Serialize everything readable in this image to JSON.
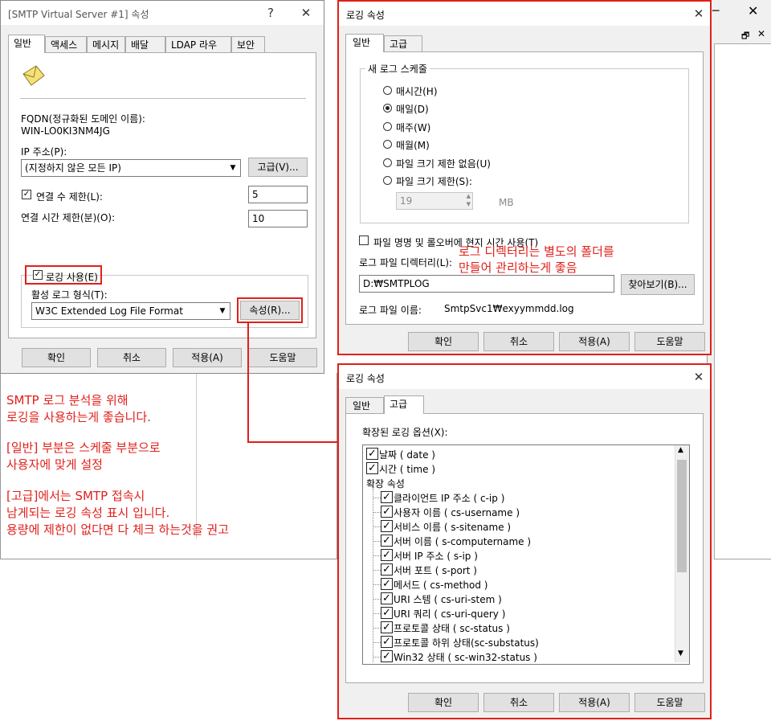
{
  "smtp_dialog": {
    "title": "[SMTP Virtual Server #1] 속성",
    "tabs": [
      "일반",
      "액세스",
      "메시지",
      "배달",
      "LDAP 라우팅",
      "보안"
    ],
    "fqdn_label": "FQDN(정규화된 도메인 이름):",
    "fqdn_value": "WIN-LO0KI3NM4JG",
    "ip_label": "IP 주소(P):",
    "ip_value": "(지정하지 않은 모든 IP)",
    "advanced_button": "고급(V)...",
    "limit_connections_label": "연결 수 제한(L):",
    "limit_connections_value": "5",
    "timeout_label": "연결 시간 제한(분)(O):",
    "timeout_value": "10",
    "enable_logging_label": "로깅 사용(E)",
    "log_format_label": "활성 로그 형식(T):",
    "log_format_value": "W3C Extended Log File Format",
    "properties_button": "속성(R)...",
    "buttons": {
      "ok": "확인",
      "cancel": "취소",
      "apply": "적용(A)",
      "help": "도움말"
    }
  },
  "logging_general": {
    "title": "로깅 속성",
    "tabs": [
      "일반",
      "고급"
    ],
    "schedule_group": "새 로그 스케줄",
    "schedule_options": [
      "매시간(H)",
      "매일(D)",
      "매주(W)",
      "매월(M)",
      "파일 크기 제한 없음(U)",
      "파일 크기 제한(S):"
    ],
    "selected_schedule": "매일(D)",
    "file_size_value": "19",
    "file_size_unit": "MB",
    "local_time_label": "파일 명명 및 롤오버에 현지 시간 사용(T)",
    "log_dir_label": "로그 파일 디렉터리(L):",
    "log_dir_value": "D:₩SMTPLOG",
    "browse_button": "찾아보기(B)...",
    "log_file_name_label": "로그 파일 이름:",
    "log_file_name_value": "SmtpSvc1₩exyymmdd.log",
    "annotation": [
      "로그 디렉터리는 별도의 폴더를",
      "만들어 관리하는게 좋음"
    ],
    "buttons": {
      "ok": "확인",
      "cancel": "취소",
      "apply": "적용(A)",
      "help": "도움말"
    }
  },
  "logging_advanced": {
    "title": "로깅 속성",
    "tabs": [
      "일반",
      "고급"
    ],
    "extended_options_label": "확장된 로깅 옵션(X):",
    "top_items": [
      "날짜 ( date )",
      "시간 ( time )"
    ],
    "group_label": "확장 속성",
    "items": [
      "클라이언트 IP 주소 ( c-ip )",
      "사용자 이름 ( cs-username )",
      "서비스 이름 ( s-sitename )",
      "서버 이름 ( s-computername )",
      "서버 IP 주소 ( s-ip )",
      "서버 포트 ( s-port )",
      "메서드 ( cs-method )",
      "URI 스템 ( cs-uri-stem )",
      "URI 쿼리 ( cs-uri-query )",
      "프로토콜 상태 ( sc-status )",
      "프로토콜 하위 상태(sc-substatus)",
      "Win32 상태 ( sc-win32-status )"
    ],
    "buttons": {
      "ok": "확인",
      "cancel": "취소",
      "apply": "적용(A)",
      "help": "도움말"
    }
  },
  "annotations": {
    "para1": [
      "SMTP 로그 분석을 위해",
      "로깅을 사용하는게 좋습니다."
    ],
    "para2": [
      "[일반] 부분은 스케줄 부분으로",
      "사용자에 맞게 설정"
    ],
    "para3": [
      "[고급]에서는 SMTP 접속시",
      "남게되는 로깅 속성 표시 입니다.",
      "용량에 제한이 없다면 다 체크 하는것을 권고"
    ]
  },
  "colors": {
    "annotation": "#e0201b",
    "dialog_bg": "#f0f0f0"
  }
}
